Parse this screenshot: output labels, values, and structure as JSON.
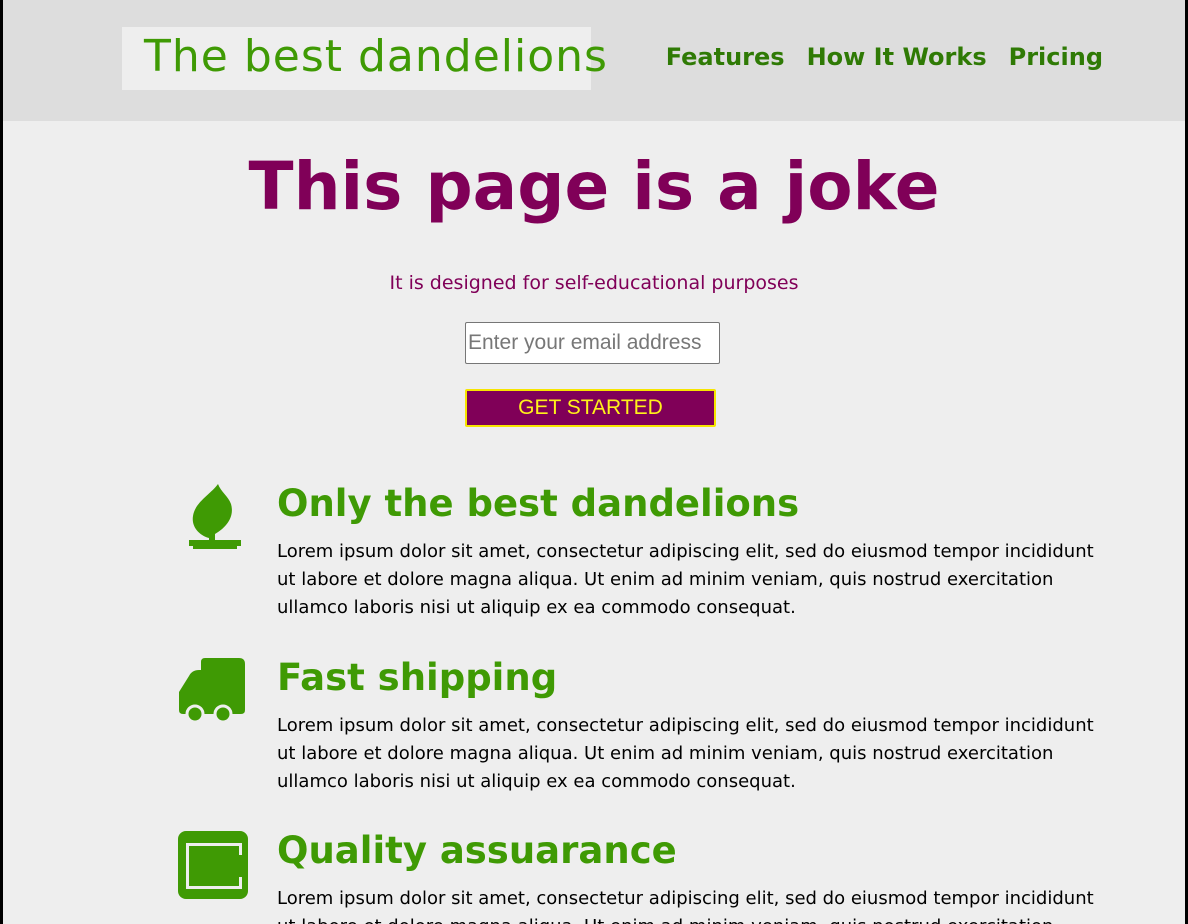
{
  "header": {
    "logo_text": "The best dandelions",
    "nav": [
      {
        "label": "Features"
      },
      {
        "label": "How It Works"
      },
      {
        "label": "Pricing"
      }
    ]
  },
  "hero": {
    "title": "This page is a joke",
    "subtitle": "It is designed for self-educational purposes",
    "email_placeholder": "Enter your email address",
    "cta_label": "GET STARTED"
  },
  "features": [
    {
      "icon": "leaf-icon",
      "title": "Only the best dandelions",
      "text": "Lorem ipsum dolor sit amet, consectetur adipiscing elit, sed do eiusmod tempor incididunt ut labore et dolore magna aliqua. Ut enim ad minim veniam, quis nostrud exercitation ullamco laboris nisi ut aliquip ex ea commodo consequat."
    },
    {
      "icon": "truck-icon",
      "title": "Fast shipping",
      "text": "Lorem ipsum dolor sit amet, consectetur adipiscing elit, sed do eiusmod tempor incididunt ut labore et dolore magna aliqua. Ut enim ad minim veniam, quis nostrud exercitation ullamco laboris nisi ut aliquip ex ea commodo consequat."
    },
    {
      "icon": "battery-icon",
      "title": "Quality assuarance",
      "text": "Lorem ipsum dolor sit amet, consectetur adipiscing elit, sed do eiusmod tempor incididunt ut labore et dolore magna aliqua. Ut enim ad minim veniam, quis nostrud exercitation ullamco laboris nisi ut aliquip ex ea commodo consequat."
    }
  ],
  "colors": {
    "brand_green": "#3f9a04",
    "brand_purple": "#800058",
    "cta_text": "#fff21a",
    "header_bg": "#dddddd",
    "page_bg": "#eeeeee"
  }
}
